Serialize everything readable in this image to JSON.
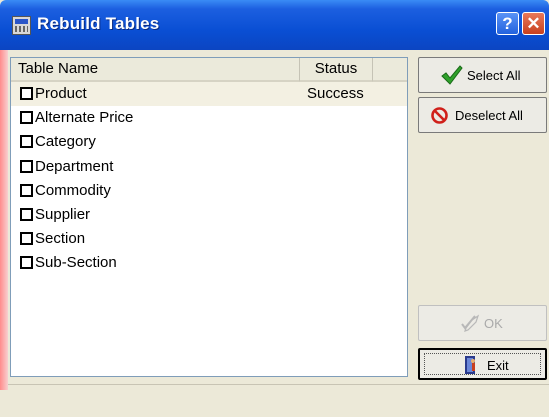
{
  "window": {
    "title": "Rebuild Tables",
    "help_label": "?",
    "close_label": "✕",
    "accent": "#0a4fd4"
  },
  "list": {
    "columns": {
      "name": "Table Name",
      "status": "Status"
    },
    "rows": [
      {
        "name": "Product",
        "status": "Success",
        "checked": false,
        "selected": true
      },
      {
        "name": "Alternate Price",
        "status": "",
        "checked": false
      },
      {
        "name": "Category",
        "status": "",
        "checked": false
      },
      {
        "name": "Department",
        "status": "",
        "checked": false
      },
      {
        "name": "Commodity",
        "status": "",
        "checked": false
      },
      {
        "name": "Supplier",
        "status": "",
        "checked": false
      },
      {
        "name": "Section",
        "status": "",
        "checked": false
      },
      {
        "name": "Sub-Section",
        "status": "",
        "checked": false
      }
    ]
  },
  "buttons": {
    "select_all": {
      "label": "Select All",
      "icon": "checkmark-icon"
    },
    "deselect_all": {
      "label": "Deselect All",
      "icon": "no-symbol-icon"
    },
    "ok": {
      "label": "OK",
      "icon": "pen-check-icon",
      "enabled": false
    },
    "exit": {
      "label": "Exit",
      "icon": "door-person-icon"
    }
  }
}
